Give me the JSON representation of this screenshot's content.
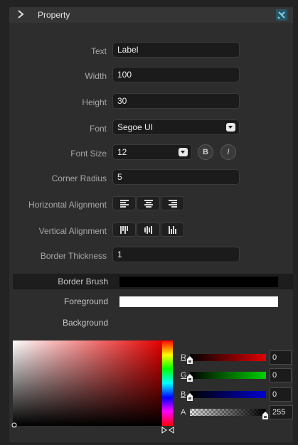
{
  "header": {
    "title": "Property"
  },
  "properties": {
    "text": {
      "label": "Text",
      "value": "Label"
    },
    "width": {
      "label": "Width",
      "value": "100"
    },
    "height": {
      "label": "Height",
      "value": "30"
    },
    "font": {
      "label": "Font",
      "value": "Segoe UI"
    },
    "font_size": {
      "label": "Font Size",
      "value": "12",
      "bold_glyph": "B",
      "italic_glyph": "I"
    },
    "corner_radius": {
      "label": "Corner Radius",
      "value": "5"
    },
    "horizontal_alignment": {
      "label": "Horizontal Alignment"
    },
    "vertical_alignment": {
      "label": "Vertical Alignment"
    },
    "border_thickness": {
      "label": "Border Thickness",
      "value": "1"
    }
  },
  "brushes": {
    "border": {
      "label": "Border Brush",
      "color": "#000000"
    },
    "foreground": {
      "label": "Foreground",
      "color": "#ffffff"
    },
    "background": {
      "label": "Background"
    }
  },
  "color_picker": {
    "r": {
      "label": "R",
      "value": "0"
    },
    "g": {
      "label": "G",
      "value": "0"
    },
    "b": {
      "label": "B",
      "value": "0"
    },
    "a": {
      "label": "A",
      "value": "255"
    }
  },
  "colors": {
    "accent_pin": "#2a5566",
    "red": "#e00000",
    "green": "#00d000",
    "blue": "#0000d0"
  }
}
